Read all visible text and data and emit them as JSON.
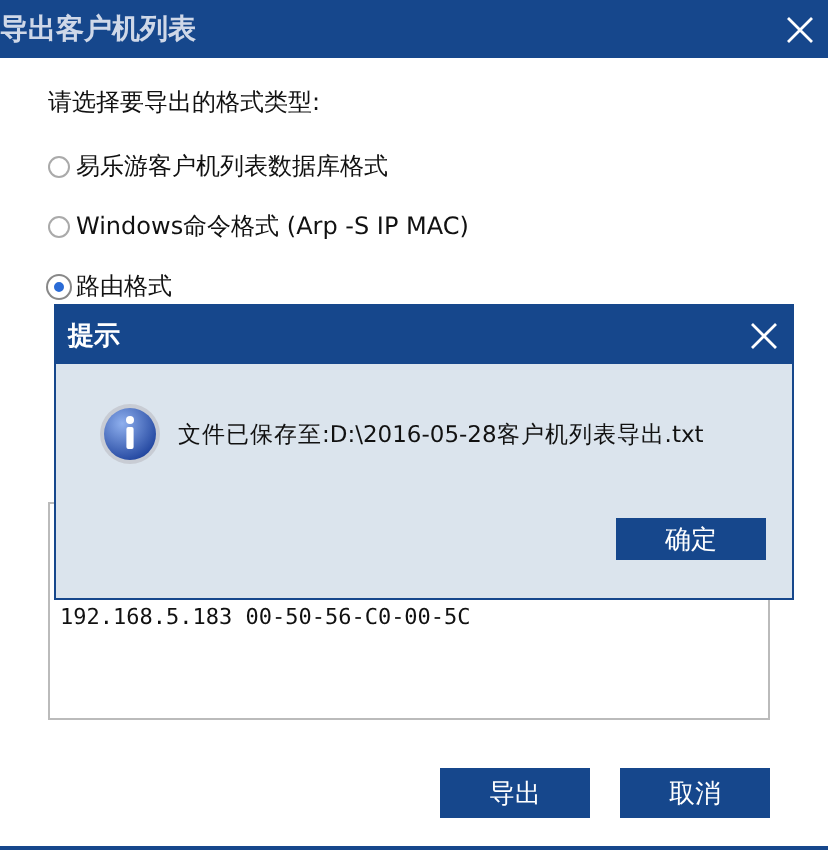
{
  "window": {
    "title": "导出客户机列表"
  },
  "prompt": "请选择要导出的格式类型:",
  "formats": [
    {
      "label": "易乐游客户机列表数据库格式",
      "selected": false
    },
    {
      "label": "Windows命令格式 (Arp -S IP MAC)",
      "selected": false
    },
    {
      "label": "路由格式",
      "selected": true
    }
  ],
  "preview": {
    "lines": [
      "192.168.5.183 00-50-56-C0-00-5C"
    ]
  },
  "buttons": [
    "导出",
    "取消"
  ],
  "dialog": {
    "title": "提示",
    "message": "文件已保存至:D:\\2016-05-28客户机列表导出.txt",
    "button": "确定"
  }
}
